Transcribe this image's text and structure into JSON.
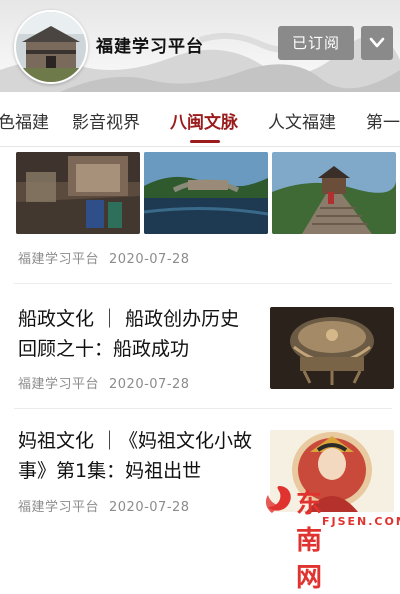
{
  "header": {
    "channel_name": "福建学习平台",
    "subscribed_label": "已订阅",
    "expand_icon": "chevron-down-icon"
  },
  "tabs": [
    {
      "label": "色福建",
      "active": false
    },
    {
      "label": "影音视界",
      "active": false
    },
    {
      "label": "八闽文脉",
      "active": true
    },
    {
      "label": "人文福建",
      "active": false
    },
    {
      "label": "第一",
      "active": false
    }
  ],
  "colors": {
    "accent": "#9b1c1c",
    "button_bg": "#8a8a8a",
    "meta_text": "#8c8c8c"
  },
  "feed": [
    {
      "type": "photo-row",
      "source": "福建学习平台",
      "date": "2020-07-28"
    },
    {
      "type": "article",
      "title": "船政文化 ｜ 船政创办历史回顾之十：船政成功",
      "source": "福建学习平台",
      "date": "2020-07-28"
    },
    {
      "type": "article",
      "title": "妈祖文化 ｜《妈祖文化小故事》第1集：妈祖出世",
      "source": "福建学习平台",
      "date": "2020-07-28"
    }
  ],
  "watermark": {
    "name": "东南网",
    "domain": "FJSEN.COM"
  }
}
